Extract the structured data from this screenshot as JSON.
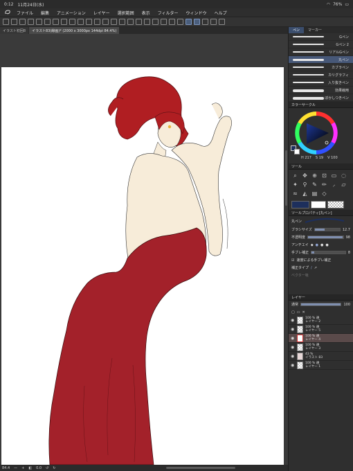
{
  "status": {
    "time": "0:12",
    "date": "11月24日(水)",
    "battery": "76%"
  },
  "menu": [
    "ファイル",
    "編集",
    "アニメーション",
    "レイヤー",
    "選択範囲",
    "表示",
    "フィルター",
    "ウィンドウ",
    "ヘルプ"
  ],
  "tabs": [
    {
      "label": "イラスト初回8",
      "active": false
    },
    {
      "label": "イラスト83(線画)* (2000 x 3000px 144dpi 84.4%)",
      "active": true
    }
  ],
  "bottom": {
    "zoom": "84.4",
    "angle": "0.0"
  },
  "brush_panel": {
    "tab_pen": "ペン",
    "tab_marker": "マーカー",
    "brushes": [
      "Gペン",
      "Gペン 2",
      "リアルGペン",
      "丸ペン",
      "カブラペン",
      "カリグラフィ",
      "入り抜きペン",
      "効果線用",
      "ぼかしつきペン"
    ],
    "active_index": 3
  },
  "color_panel": {
    "title": "カラーサークル",
    "h": "217",
    "s": "19",
    "v": "100",
    "h_label": "H",
    "s_label": "S",
    "v_label": "V",
    "main_color": "#1d2f5c",
    "sub_color": "#ffffff"
  },
  "tool_panel": {
    "title": "ツール"
  },
  "tool_property": {
    "title": "ツールプロパティ[丸ペン]",
    "brush_name": "丸ペン",
    "brush_size_label": "ブラシサイズ",
    "brush_size": "12.7",
    "opacity_label": "不透明度",
    "opacity": "98",
    "antialias_label": "アンチエイ",
    "stabilize_label": "手ブレ補正",
    "stabilize": "8",
    "speed_label": "速度による手ブレ補正",
    "correction_label": "補正タイプ",
    "vector_label": "ベクター吸"
  },
  "layer_panel": {
    "title": "レイヤー",
    "mode": "通常",
    "opacity": "100",
    "layers": [
      {
        "pct": "100 %",
        "mode": "通",
        "name": "レイヤー 2"
      },
      {
        "pct": "100 %",
        "mode": "通",
        "name": "レイヤー 5"
      },
      {
        "pct": "100 %",
        "mode": "通",
        "name": "レイヤー 4",
        "active": true
      },
      {
        "pct": "100 %",
        "mode": "通",
        "name": "レイヤー 3"
      },
      {
        "pct": "43 %",
        "mode": "",
        "name": "イラスト 83"
      },
      {
        "pct": "100 %",
        "mode": "通",
        "name": "レイヤー 1"
      }
    ]
  },
  "colors": {
    "dress": "#a3212a",
    "hair": "#b01e22",
    "skin": "#f7ecd9",
    "accent": "#4a5e7c"
  }
}
